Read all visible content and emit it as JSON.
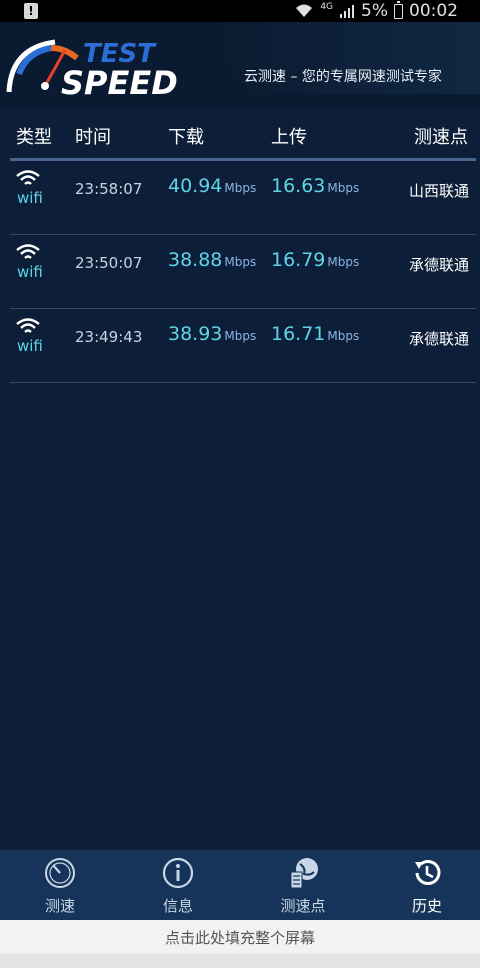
{
  "status_bar": {
    "network": "4G",
    "battery": "5%",
    "time": "00:02",
    "warning": "!"
  },
  "header": {
    "logo_top": "TEST",
    "logo_bottom": "SPEED",
    "tagline": "云测速 – 您的专属网速测试专家"
  },
  "table": {
    "columns": [
      "类型",
      "时间",
      "下载",
      "上传",
      "测速点"
    ],
    "rows": [
      {
        "type": "wifi",
        "time": "23:58:07",
        "download": "40.94",
        "download_unit": "Mbps",
        "upload": "16.63",
        "upload_unit": "Mbps",
        "node": "山西联通"
      },
      {
        "type": "wifi",
        "time": "23:50:07",
        "download": "38.88",
        "download_unit": "Mbps",
        "upload": "16.79",
        "upload_unit": "Mbps",
        "node": "承德联通"
      },
      {
        "type": "wifi",
        "time": "23:49:43",
        "download": "38.93",
        "download_unit": "Mbps",
        "upload": "16.71",
        "upload_unit": "Mbps",
        "node": "承德联通"
      }
    ]
  },
  "tabs": [
    {
      "label": "测速",
      "icon": "speedometer-icon",
      "active": false
    },
    {
      "label": "信息",
      "icon": "info-icon",
      "active": false
    },
    {
      "label": "测速点",
      "icon": "globe-server-icon",
      "active": false
    },
    {
      "label": "历史",
      "icon": "history-icon",
      "active": true
    }
  ],
  "ad_bar": {
    "text": "点击此处填充整个屏幕"
  },
  "colors": {
    "background": "#0d1f38",
    "accent": "#5fd3e8",
    "tab_bar": "#16345a"
  }
}
